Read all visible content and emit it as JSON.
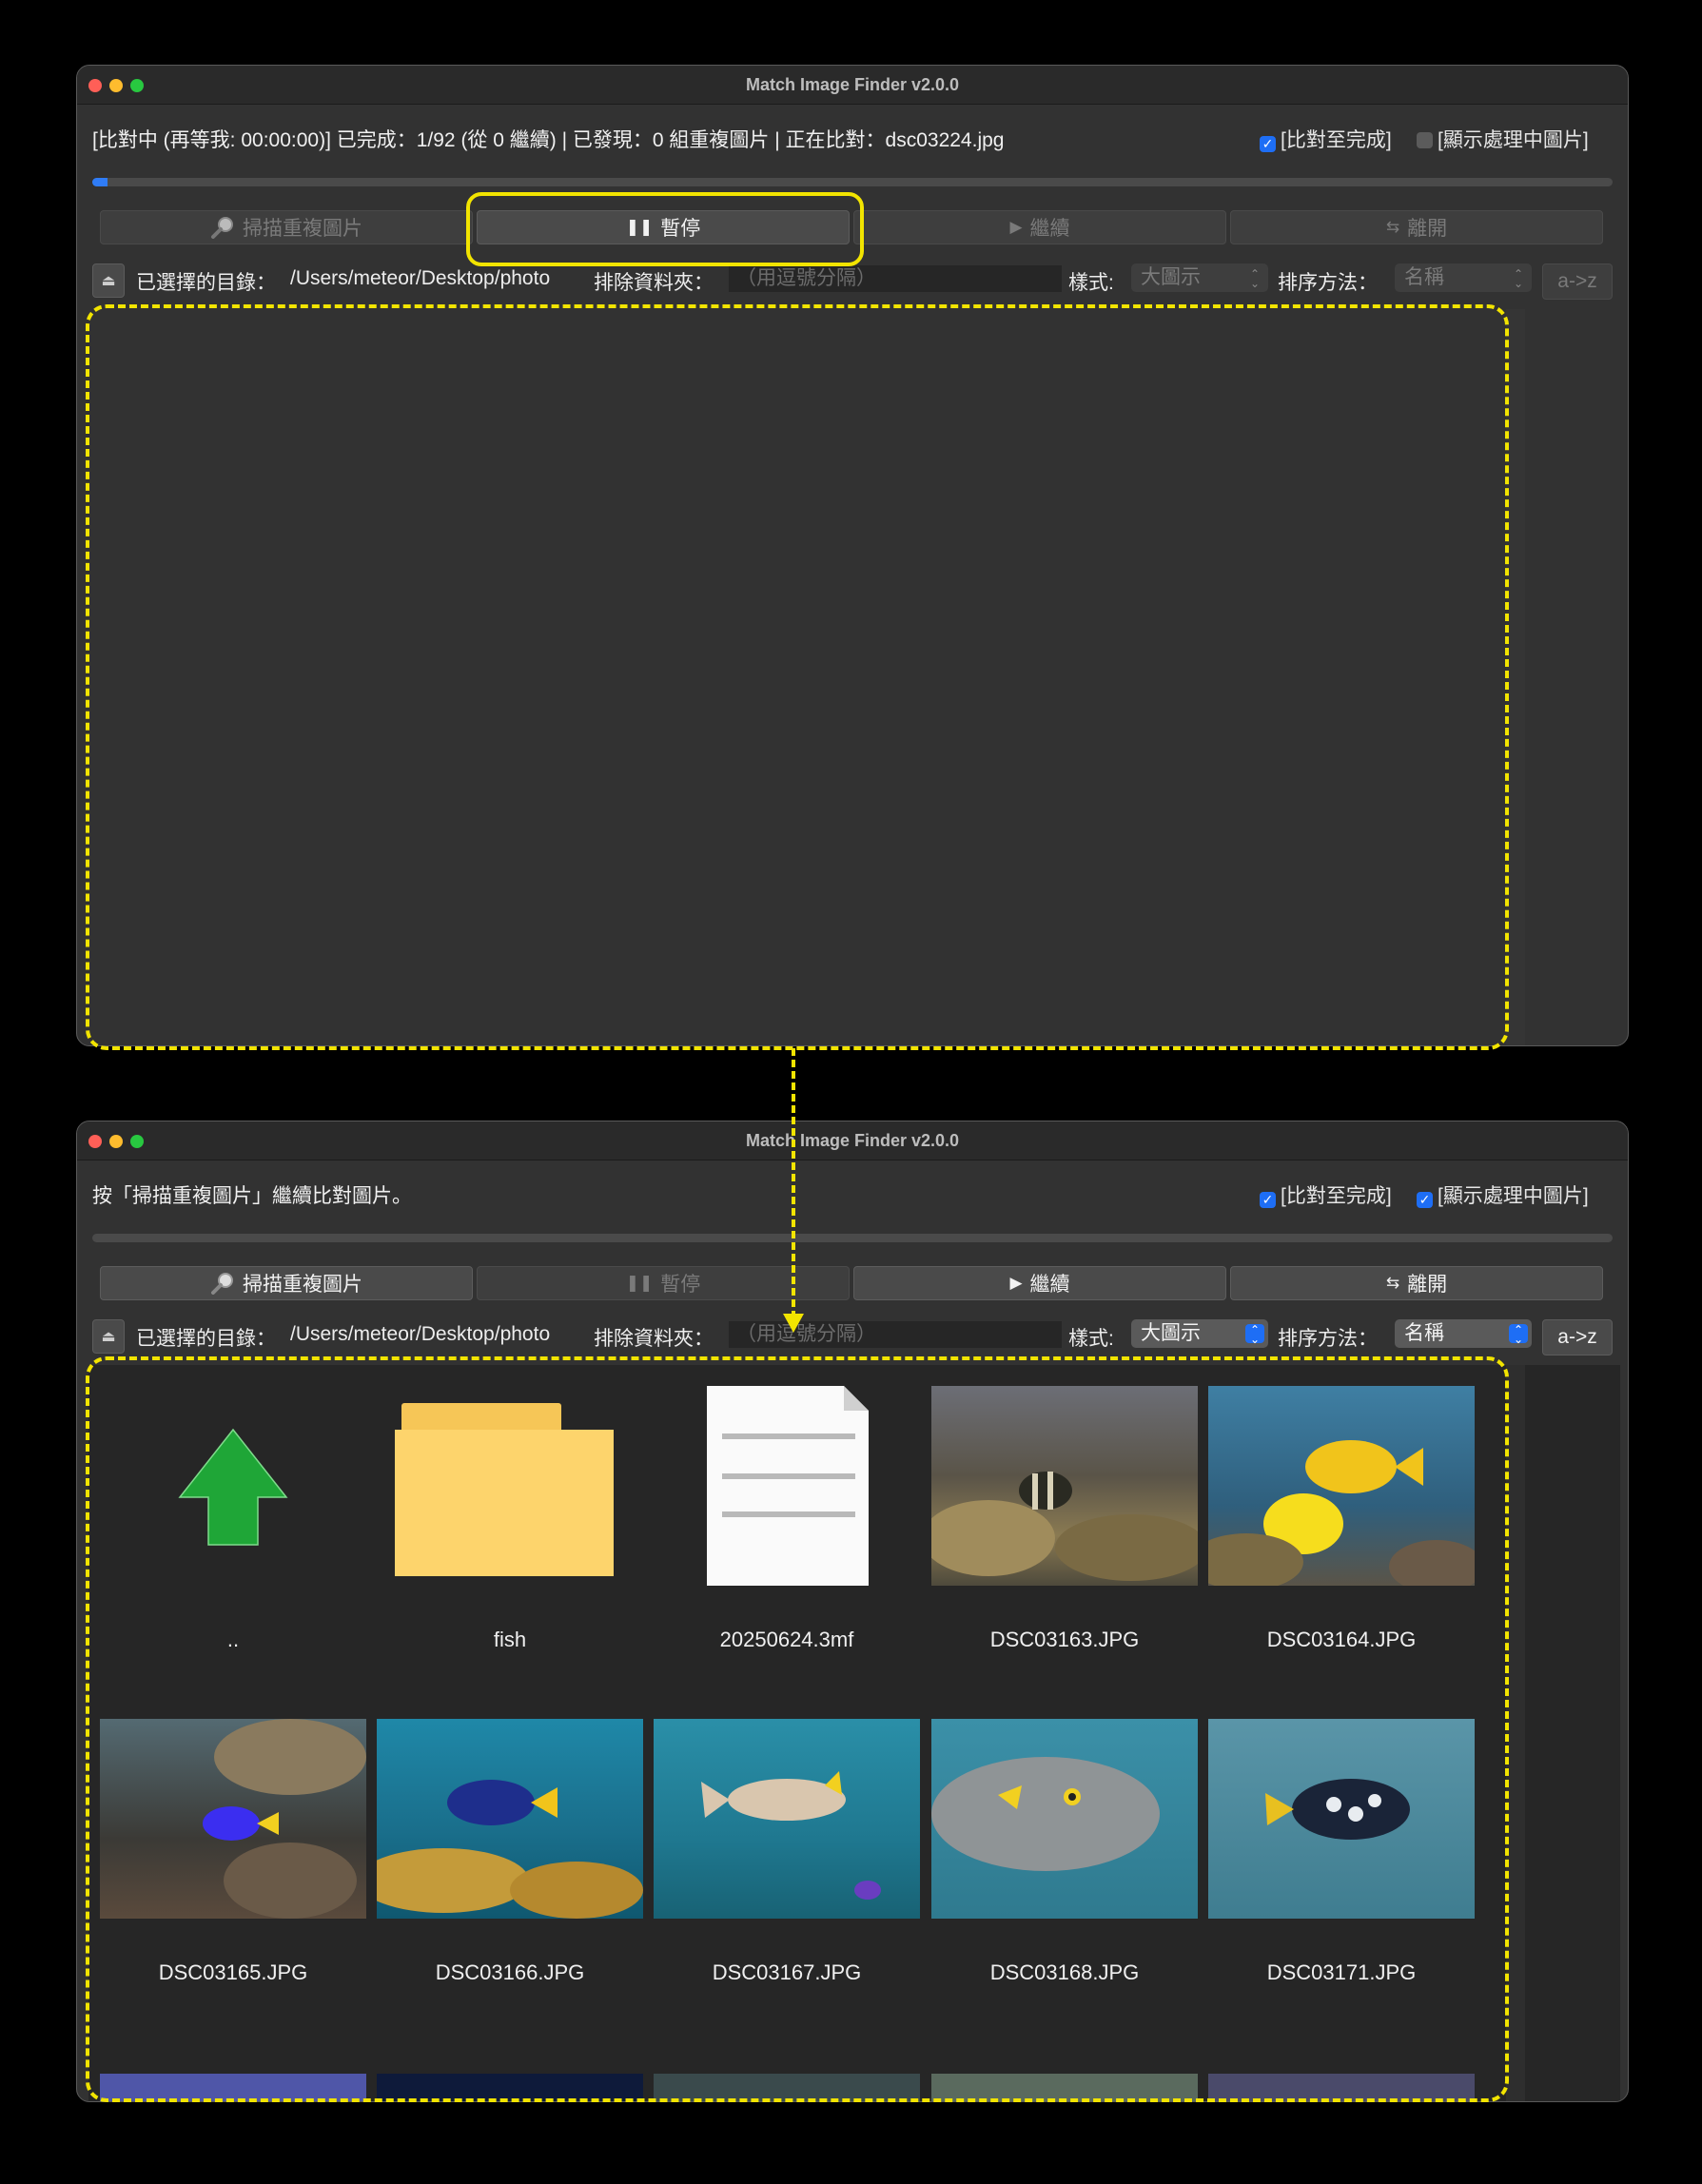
{
  "window_title": "Match Image Finder v2.0.0",
  "window1": {
    "status": "[比對中 (再等我: 00:00:00)] 已完成：1/92 (從 0 繼續) | 已發現：0 組重複圖片 | 正在比對：dsc03224.jpg",
    "compare_to_end_label": "[比對至完成]",
    "compare_to_end_checked": true,
    "show_processing_label": "[顯示處理中圖片]",
    "show_processing_checked": false,
    "progress": 0.01
  },
  "window2": {
    "status": "按「掃描重複圖片」繼續比對圖片。",
    "compare_to_end_label": "[比對至完成]",
    "compare_to_end_checked": true,
    "show_processing_label": "[顯示處理中圖片]",
    "show_processing_checked": true,
    "progress": 0
  },
  "buttons": {
    "scan": "掃描重複圖片",
    "pause": "暫停",
    "resume": "繼續",
    "exit": "離開"
  },
  "toolbar": {
    "selected_dir_label": "已選擇的目錄：",
    "selected_dir_path": "/Users/meteor/Desktop/photo",
    "exclude_label": "排除資料夾：",
    "exclude_placeholder": "（用逗號分隔）",
    "style_label": "樣式:",
    "style_value": "大圖示",
    "sort_label": "排序方法：",
    "sort_value": "名稱",
    "sort_order": "a->z"
  },
  "files": [
    {
      "name": "..",
      "kind": "up-arrow"
    },
    {
      "name": "fish",
      "kind": "folder"
    },
    {
      "name": "20250624.3mf",
      "kind": "document"
    },
    {
      "name": "DSC03163.JPG",
      "kind": "photo"
    },
    {
      "name": "DSC03164.JPG",
      "kind": "photo"
    },
    {
      "name": "DSC03165.JPG",
      "kind": "photo"
    },
    {
      "name": "DSC03166.JPG",
      "kind": "photo"
    },
    {
      "name": "DSC03167.JPG",
      "kind": "photo"
    },
    {
      "name": "DSC03168.JPG",
      "kind": "photo"
    },
    {
      "name": "DSC03171.JPG",
      "kind": "photo"
    }
  ],
  "colors": {
    "annotation": "#f2e400",
    "accent": "#1e6ef5",
    "window_bg": "#323232"
  }
}
